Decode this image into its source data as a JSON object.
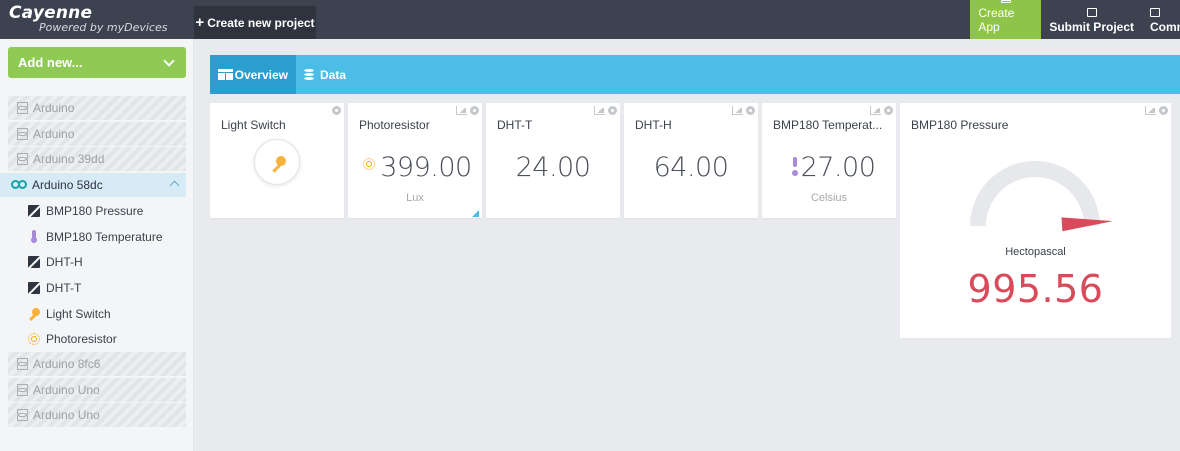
{
  "brand": {
    "name": "Cayenne",
    "subtitle": "Powered by myDevices"
  },
  "header": {
    "create_project": "Create new project",
    "actions": [
      {
        "label": "Create App",
        "color": "#8ec549"
      },
      {
        "label": "Submit Project"
      },
      {
        "label": "Commu"
      }
    ]
  },
  "sidebar": {
    "add_new": "Add new...",
    "devices_before": [
      "Arduino",
      "Arduino",
      "Arduino 39dd"
    ],
    "active_device": "Arduino 58dc",
    "sensors": [
      {
        "label": "BMP180 Pressure",
        "icon": "chart-icon"
      },
      {
        "label": "BMP180 Temperature",
        "icon": "thermometer-icon"
      },
      {
        "label": "DHT-H",
        "icon": "chart-icon"
      },
      {
        "label": "DHT-T",
        "icon": "chart-icon"
      },
      {
        "label": "Light Switch",
        "icon": "bulb-icon"
      },
      {
        "label": "Photoresistor",
        "icon": "sun-icon"
      }
    ],
    "devices_after": [
      "Arduino 8fc6",
      "Arduino Uno",
      "Arduino Uno"
    ]
  },
  "tabs": [
    {
      "label": "Overview",
      "icon": "grid-icon"
    },
    {
      "label": "Data",
      "icon": "database-icon"
    }
  ],
  "widgets": {
    "light_switch": {
      "title": "Light Switch"
    },
    "photoresistor": {
      "title": "Photoresistor",
      "value": "399.00",
      "unit": "Lux"
    },
    "dht_t": {
      "title": "DHT-T",
      "value": "24.00"
    },
    "dht_h": {
      "title": "DHT-H",
      "value": "64.00"
    },
    "bmp_temp": {
      "title": "BMP180 Temperat...",
      "value": "27.00",
      "unit": "Celsius"
    },
    "bmp_pressure": {
      "title": "BMP180 Pressure",
      "label": "Hectopascal",
      "value": "995.56",
      "gauge_fraction": 0.98
    }
  },
  "colors": {
    "accent_green": "#8fca54",
    "accent_blue": "#4bbde6",
    "gauge_red": "#d94b5a",
    "topbar": "#3d4250"
  }
}
